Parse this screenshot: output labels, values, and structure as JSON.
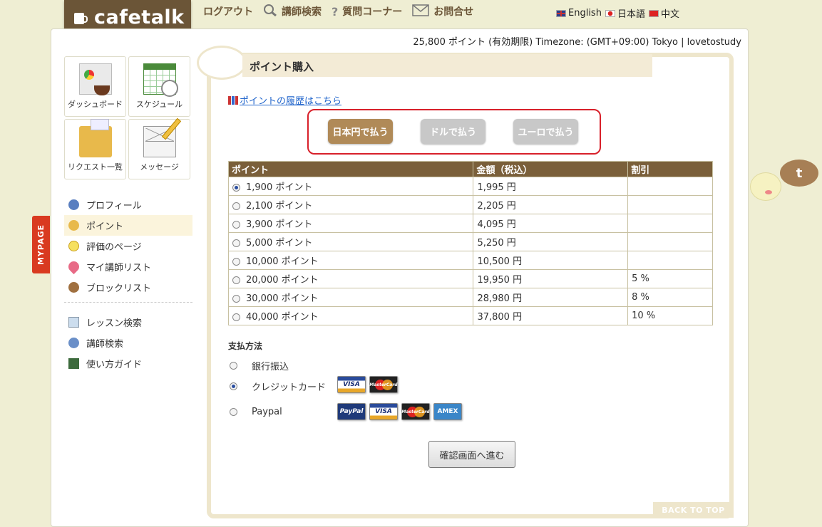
{
  "header": {
    "brand": "cafetalk",
    "nav": [
      {
        "label": "ログアウト"
      },
      {
        "label": "講師検索"
      },
      {
        "label": "質問コーナー"
      },
      {
        "label": "お問合せ"
      }
    ],
    "languages": [
      {
        "label": "English"
      },
      {
        "label": "日本語"
      },
      {
        "label": "中文"
      }
    ],
    "info": "25,800 ポイント (有効期限) Timezone: (GMT+09:00) Tokyo | lovetostudy"
  },
  "sidebar": {
    "tiles": [
      {
        "label": "ダッシュボード"
      },
      {
        "label": "スケジュール"
      },
      {
        "label": "リクエスト一覧"
      },
      {
        "label": "メッセージ"
      }
    ],
    "menu": [
      {
        "label": "プロフィール"
      },
      {
        "label": "ポイント"
      },
      {
        "label": "評価のページ"
      },
      {
        "label": "マイ講師リスト"
      },
      {
        "label": "ブロックリスト"
      }
    ],
    "menu2": [
      {
        "label": "レッスン検索"
      },
      {
        "label": "講師検索"
      },
      {
        "label": "使い方ガイド"
      }
    ],
    "mypage_tab": "MYPAGE"
  },
  "main": {
    "title": "ポイント購入",
    "history_link": "ポイントの履歴はこちら",
    "currency_buttons": [
      {
        "label": "日本円で払う"
      },
      {
        "label": "ドルで払う"
      },
      {
        "label": "ユーロで払う"
      }
    ],
    "table": {
      "headers": [
        "ポイント",
        "金額（税込）",
        "割引"
      ],
      "rows": [
        {
          "points": "1,900 ポイント",
          "price": "1,995 円",
          "discount": ""
        },
        {
          "points": "2,100 ポイント",
          "price": "2,205 円",
          "discount": ""
        },
        {
          "points": "3,900 ポイント",
          "price": "4,095 円",
          "discount": ""
        },
        {
          "points": "5,000 ポイント",
          "price": "5,250 円",
          "discount": ""
        },
        {
          "points": "10,000 ポイント",
          "price": "10,500 円",
          "discount": ""
        },
        {
          "points": "20,000 ポイント",
          "price": "19,950 円",
          "discount": "5 %"
        },
        {
          "points": "30,000 ポイント",
          "price": "28,980 円",
          "discount": "8 %"
        },
        {
          "points": "40,000 ポイント",
          "price": "37,800 円",
          "discount": "10 %"
        }
      ]
    },
    "payment_title": "支払方法",
    "payment_methods": [
      {
        "label": "銀行振込"
      },
      {
        "label": "クレジットカード"
      },
      {
        "label": "Paypal"
      }
    ],
    "cards": {
      "visa": "VISA",
      "mastercard": "MasterCard",
      "paypal": "PayPal",
      "amex": "AMEX"
    },
    "confirm_button": "確認画面へ進む",
    "back_to_top": "BACK TO TOP"
  },
  "colors": {
    "brand": "#6b5537",
    "accent_red": "#d8202a",
    "active_button": "#b08a58",
    "table_header": "#7a5f3a"
  }
}
